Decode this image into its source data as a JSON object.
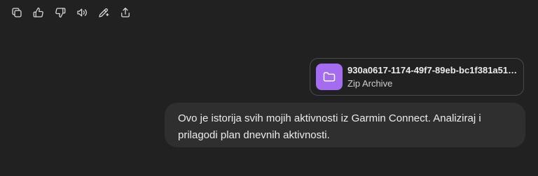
{
  "toolbar": {
    "buttons": [
      {
        "name": "copy-button",
        "icon": "copy-icon"
      },
      {
        "name": "thumbs-up-button",
        "icon": "thumbs-up-icon"
      },
      {
        "name": "thumbs-down-button",
        "icon": "thumbs-down-icon"
      },
      {
        "name": "read-aloud-button",
        "icon": "speaker-icon"
      },
      {
        "name": "edit-button",
        "icon": "magic-pen-icon"
      },
      {
        "name": "share-button",
        "icon": "share-icon"
      }
    ]
  },
  "attachment": {
    "file_name": "930a0617-1174-49f7-89eb-bc1f381a51b…",
    "file_type": "Zip Archive",
    "icon": "folder-icon",
    "icon_color": "#a56bf0"
  },
  "user_message": {
    "text": "Ovo je istorija svih mojih aktivnosti iz Garmin Connect. Analiziraj i prilagodi plan dnevnih aktivnosti."
  }
}
